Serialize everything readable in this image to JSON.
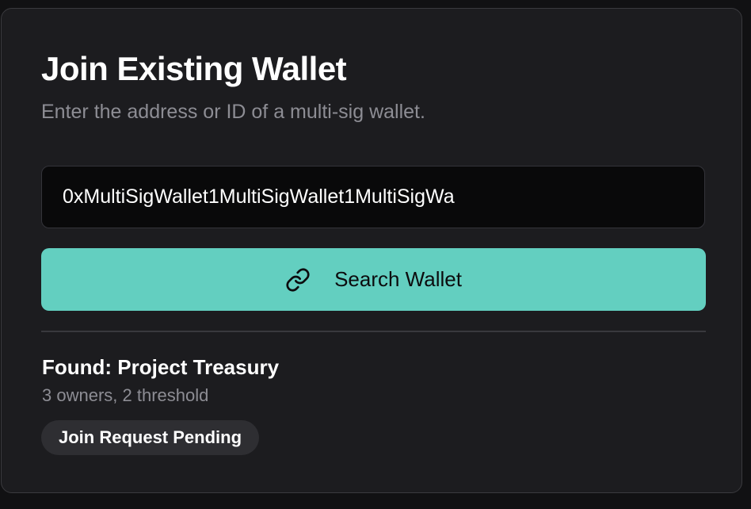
{
  "join_wallet": {
    "title": "Join Existing Wallet",
    "subtitle": "Enter the address or ID of a multi-sig wallet.",
    "address_input": {
      "value": "0xMultiSigWallet1MultiSigWallet1MultiSigWa"
    },
    "search_button": {
      "icon": "link-icon",
      "label": "Search Wallet"
    }
  },
  "result": {
    "found_label": "Found: Project Treasury",
    "details": "3 owners, 2 threshold",
    "status": "Join Request Pending"
  },
  "colors": {
    "accent": "#63cfc0",
    "card_background": "#1c1c1f",
    "input_background": "#09090a",
    "muted_text": "#8d8d94",
    "badge_background": "#2e2e32"
  }
}
